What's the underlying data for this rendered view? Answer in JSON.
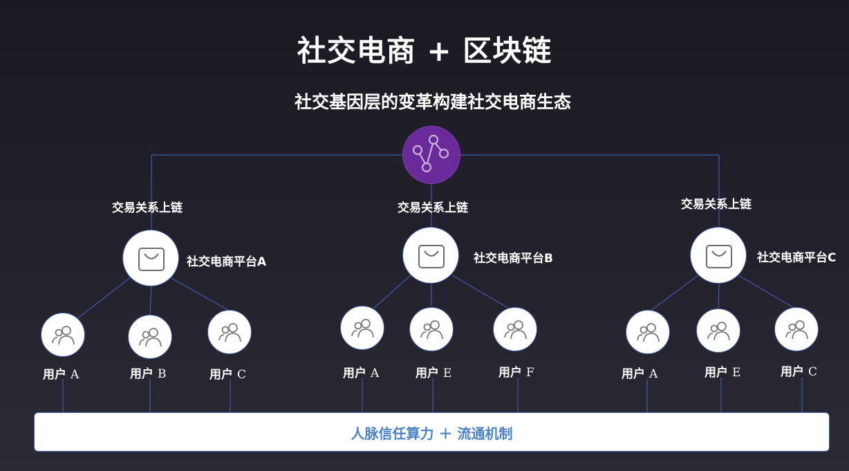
{
  "title": "社交电商 + 区块链",
  "subtitle": "社交基因层的变革构建社交电商生态",
  "hub": {
    "icon": "blockchain-network-icon",
    "color": "#6a2a9a"
  },
  "branches": [
    {
      "chain_label": "交易关系上链",
      "platform": {
        "label": "社交电商平台A",
        "icon": "shopping-bag-icon"
      },
      "users": [
        {
          "label": "用户",
          "letter": "A"
        },
        {
          "label": "用户",
          "letter": "B"
        },
        {
          "label": "用户",
          "letter": "C"
        }
      ]
    },
    {
      "chain_label": "交易关系上链",
      "platform": {
        "label": "社交电商平台B",
        "icon": "shopping-bag-icon"
      },
      "users": [
        {
          "label": "用户",
          "letter": "A"
        },
        {
          "label": "用户",
          "letter": "E"
        },
        {
          "label": "用户",
          "letter": "F"
        }
      ]
    },
    {
      "chain_label": "交易关系上链",
      "platform": {
        "label": "社交电商平台C",
        "icon": "shopping-bag-icon"
      },
      "users": [
        {
          "label": "用户",
          "letter": "A"
        },
        {
          "label": "用户",
          "letter": "E"
        },
        {
          "label": "用户",
          "letter": "C"
        }
      ]
    }
  ],
  "base_bar": {
    "label": "人脉信任算力 ＋ 流通机制",
    "text_color": "#4a83c9"
  },
  "line_color": "#3e5ea8"
}
